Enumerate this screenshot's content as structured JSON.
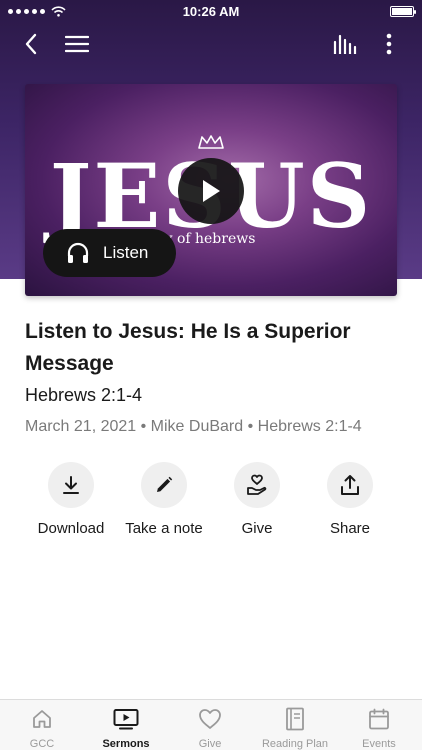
{
  "status_bar": {
    "time": "10:26 AM",
    "battery_level": 1.0
  },
  "nav": {
    "back_icon": "chevron-left-icon",
    "menu_icon": "hamburger-menu-icon",
    "audio_icon": "audio-levels-icon",
    "more_icon": "vertical-more-icon"
  },
  "artwork": {
    "title": "JESUS",
    "subtitle": "a study of hebrews",
    "play_icon": "play-icon",
    "listen_label": "Listen",
    "colors": {
      "background": "#4b2062",
      "button": "#151515"
    }
  },
  "sermon": {
    "title": "Listen to Jesus: He Is a Superior Message",
    "scripture": "Hebrews 2:1-4",
    "meta": "March 21, 2021 • Mike DuBard • Hebrews 2:1-4"
  },
  "actions": [
    {
      "label": "Download",
      "icon": "download-icon"
    },
    {
      "label": "Take a note",
      "icon": "pencil-icon"
    },
    {
      "label": "Give",
      "icon": "heart-hand-icon"
    },
    {
      "label": "Share",
      "icon": "share-icon"
    }
  ],
  "tabs": [
    {
      "label": "GCC",
      "icon": "home-icon",
      "active": false
    },
    {
      "label": "Sermons",
      "icon": "tv-play-icon",
      "active": true
    },
    {
      "label": "Give",
      "icon": "heart-icon",
      "active": false
    },
    {
      "label": "Reading Plan",
      "icon": "book-icon",
      "active": false
    },
    {
      "label": "Events",
      "icon": "calendar-icon",
      "active": false
    }
  ]
}
